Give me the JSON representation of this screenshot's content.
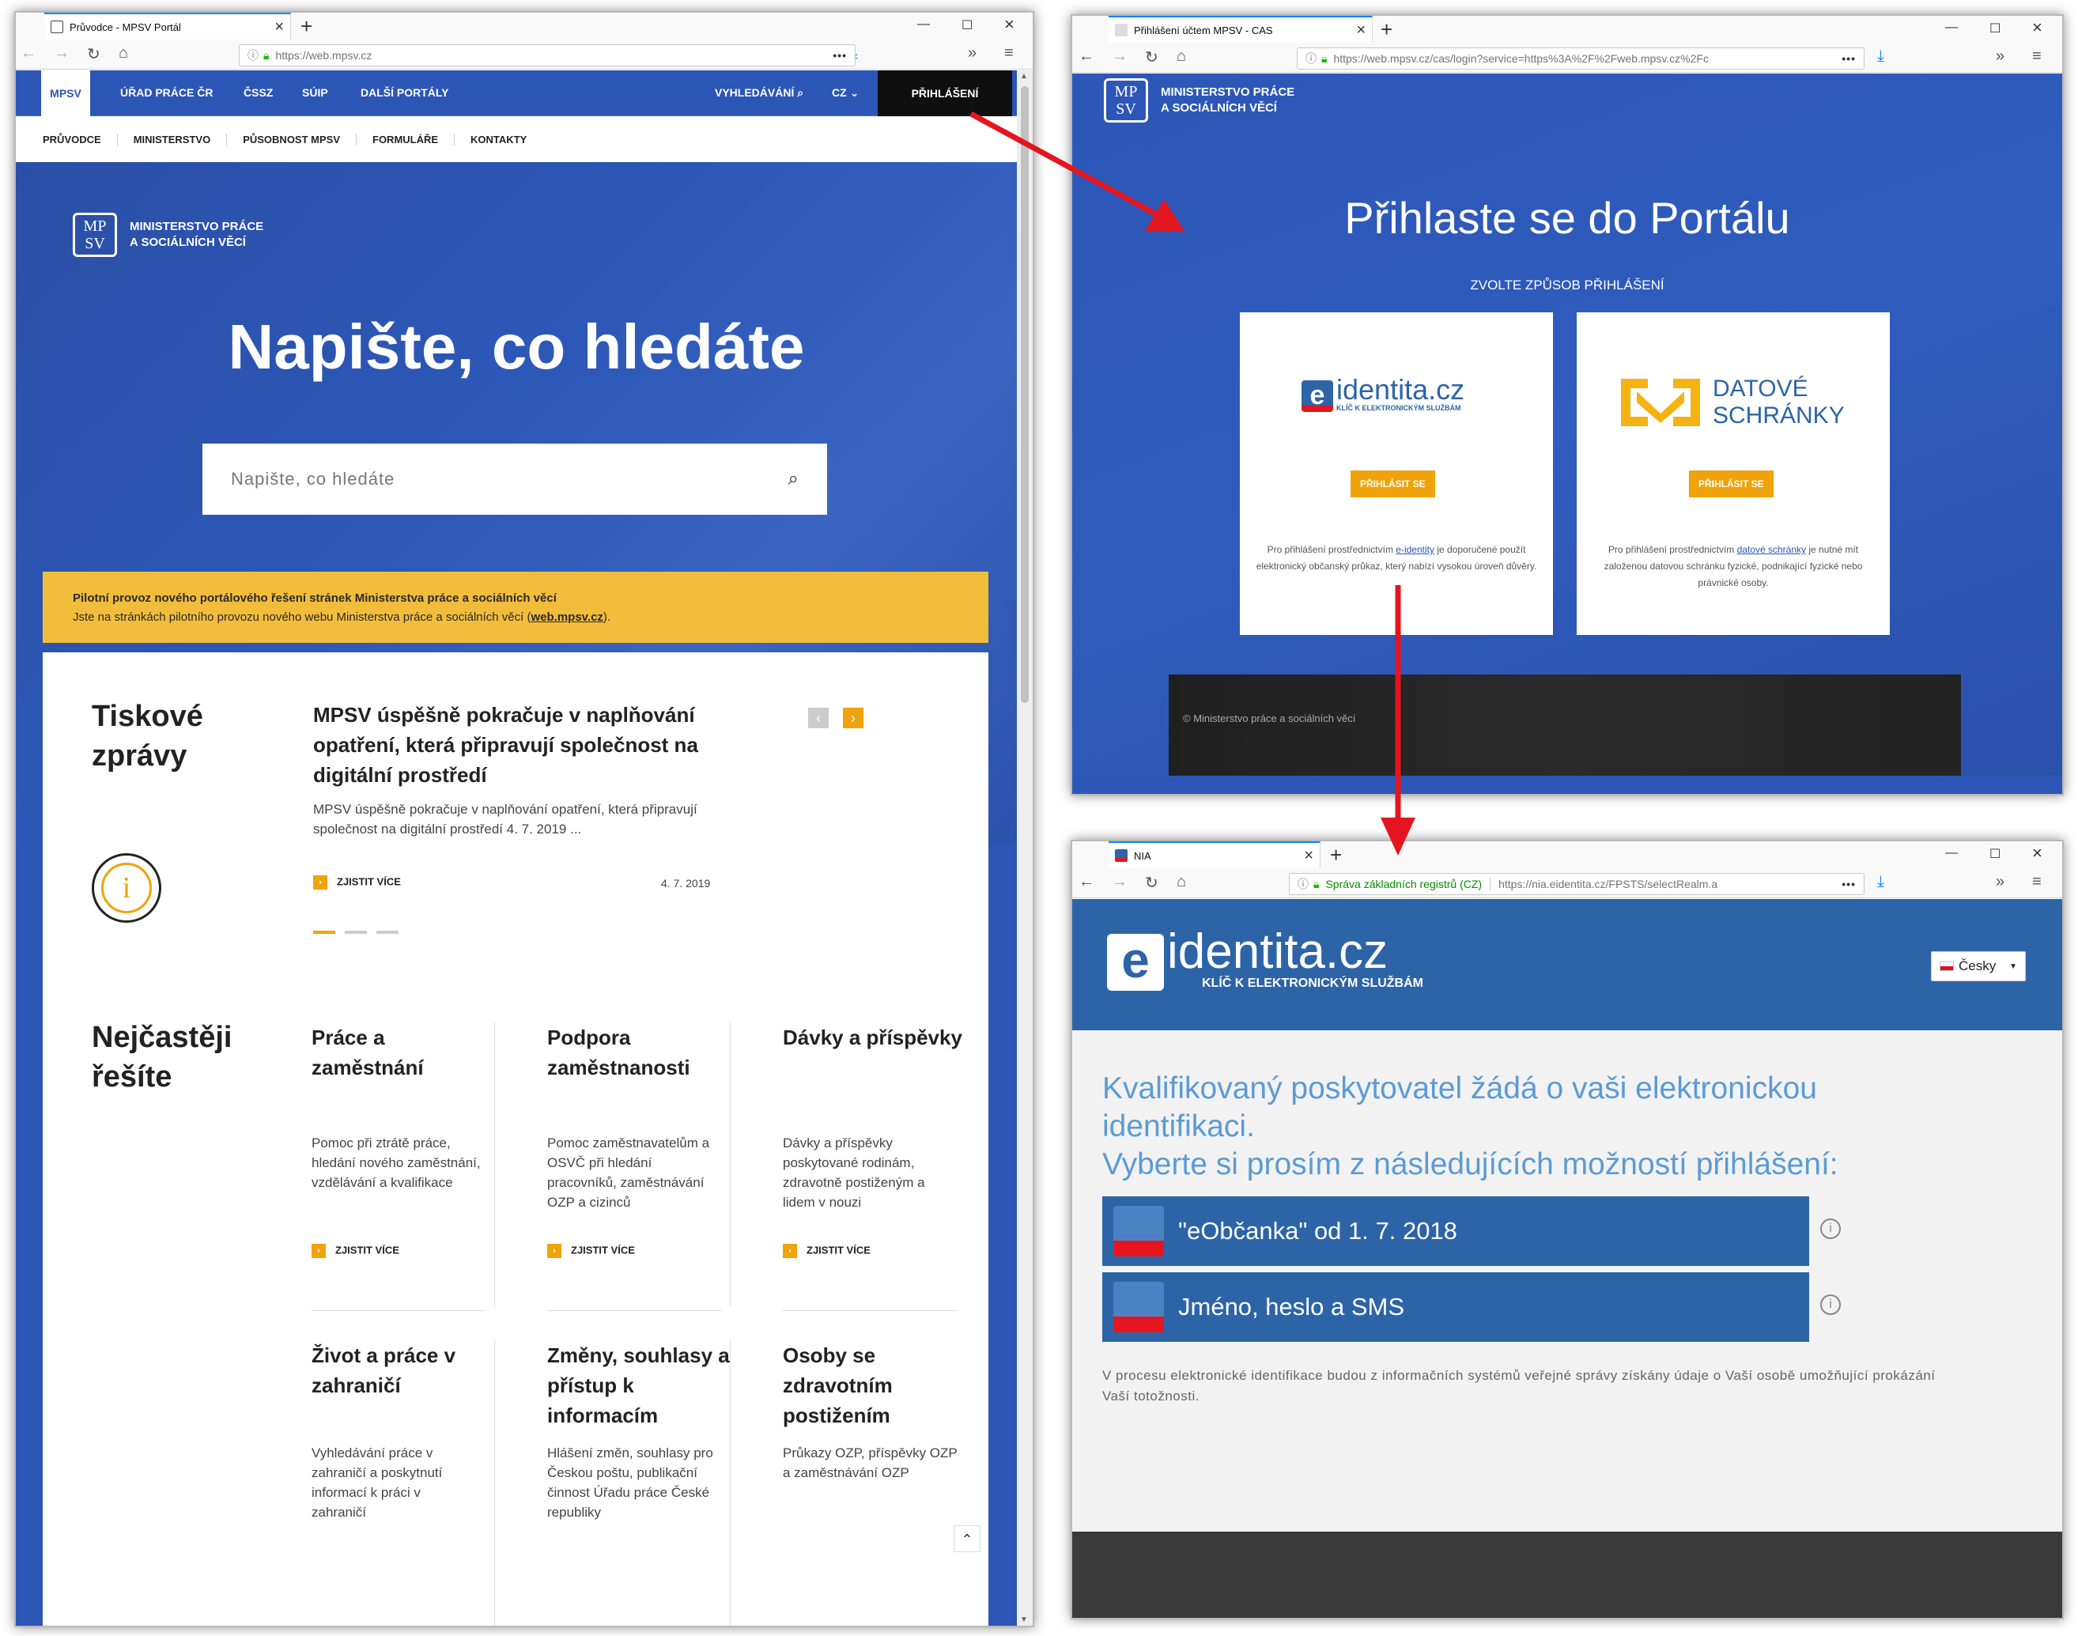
{
  "left_window": {
    "tab_title": "Průvodce - MPSV Portál",
    "url": "https://web.mpsv.cz",
    "url_domain": "mpsv.cz",
    "topnav": [
      "MPSV",
      "ÚŘAD PRÁCE ČR",
      "ČSSZ",
      "SÚIP",
      "DALŠÍ PORTÁLY"
    ],
    "search_label": "VYHLEDÁVÁNÍ",
    "lang": "CZ",
    "login": "PŘIHLÁŠENÍ",
    "subnav": [
      "PRŮVODCE",
      "MINISTERSTVO",
      "PŮSOBNOST MPSV",
      "FORMULÁŘE",
      "KONTAKTY"
    ],
    "logo_line1": "MINISTERSTVO PRÁCE",
    "logo_line2": "A SOCIÁLNÍCH VĚCÍ",
    "logo_mark": "MPSV",
    "hero_title": "Napište, co hledáte",
    "search_placeholder": "Napište, co hledáte",
    "notice_line1": "Pilotní provoz nového portálového řešení stránek Ministerstva práce a sociálních věcí",
    "notice_line2": "Jste na stránkách pilotního provozu nového webu Ministerstva práce a sociálních věcí (",
    "notice_link": "web.mpsv.cz",
    "notice_end": ").",
    "press_heading": "Tiskové zprávy",
    "press_title": "MPSV úspěšně pokračuje v naplňování opatření, která připravují společnost na digitální prostředí",
    "press_text": "MPSV úspěšně pokračuje v naplňování opatření, která připravují společnost na digitální prostředí 4. 7. 2019 ...",
    "more": "ZJISTIT VÍCE",
    "press_date": "4. 7. 2019",
    "faq_heading": "Nejčastěji řešíte",
    "cards": [
      {
        "title": "Práce a zaměstnání",
        "text": "Pomoc při ztrátě práce, hledání nového zaměstnání, vzdělávání a kvalifikace"
      },
      {
        "title": "Podpora zaměstnanosti",
        "text": "Pomoc zaměstnavatelům a OSVČ při hledání pracovníků, zaměstnávání OZP a cizinců"
      },
      {
        "title": "Dávky a příspěvky",
        "text": "Dávky a příspěvky poskytované rodinám, zdravotně postiženým a lidem v nouzi"
      },
      {
        "title": "Život a práce v zahraničí",
        "text": "Vyhledávání práce v zahraničí a poskytnutí informací k práci v zahraničí"
      },
      {
        "title": "Změny, souhlasy a přístup k informacím",
        "text": "Hlášení změn, souhlasy pro Českou poštu, publikační činnost Úřadu práce České republiky"
      },
      {
        "title": "Osoby se zdravotním postižením",
        "text": "Průkazy OZP, příspěvky OZP a zaměstnávání OZP"
      }
    ]
  },
  "top_right_window": {
    "tab_title": "Přihlášení účtem MPSV - CAS",
    "url": "https://web.mpsv.cz/cas/login?service=https%3A%2F%2Fweb.mpsv.cz%2Fc",
    "heading": "Přihlaste se do Portálu",
    "subheading": "ZVOLTE ZPŮSOB PŘIHLÁŠENÍ",
    "eid_logo": "identita.cz",
    "eid_tagline": "KLÍČ K ELEKTRONICKÝM SLUŽBÁM",
    "ds_logo_line1": "DATOVÉ",
    "ds_logo_line2": "SCHRÁNKY",
    "login_btn": "PŘIHLÁSIT SE",
    "eid_desc_a": "Pro přihlášení prostřednictvím ",
    "eid_desc_link": "e-identity",
    "eid_desc_b": " je doporučené použít elektronický občanský průkaz, který nabízí vysokou úroveň důvěry.",
    "ds_desc_a": "Pro přihlášení prostřednictvím ",
    "ds_desc_link": "datové schránky",
    "ds_desc_b": " je nutné mít založenou datovou schránku fyzické, podnikající fyzické nebo právnické osoby.",
    "footer": "© Ministerstvo práce a sociálních věcí"
  },
  "bottom_right_window": {
    "tab_title": "NIA",
    "identity": "Správa základních registrů (CZ)",
    "url": "https://nia.eidentita.cz/FPSTS/selectRealm.a",
    "logo_e": "e-",
    "logo_main": "identita.cz",
    "logo_tagline": "KLÍČ K ELEKTRONICKÝM SLUŽBÁM",
    "lang": "Česky",
    "heading_line1": "Kvalifikovaný poskytovatel žádá o vaši elektronickou",
    "heading_line2": "identifikaci.",
    "heading_line3": "Vyberte si prosím z následujících možností přihlášení:",
    "options": [
      "\"eObčanka\" od 1. 7. 2018",
      "Jméno, heslo a SMS"
    ],
    "note": "V procesu elektronické identifikace budou z informačních systémů veřejné správy získány údaje o Vaší osobě umožňující prokázání Vaší totožnosti."
  },
  "colors": {
    "mpsv_blue": "#2b56b5",
    "yellow": "#f0a30a",
    "notice_yellow": "#f3bd3c",
    "nia_blue": "#2d64a8",
    "arrow_red": "#e4151f"
  }
}
